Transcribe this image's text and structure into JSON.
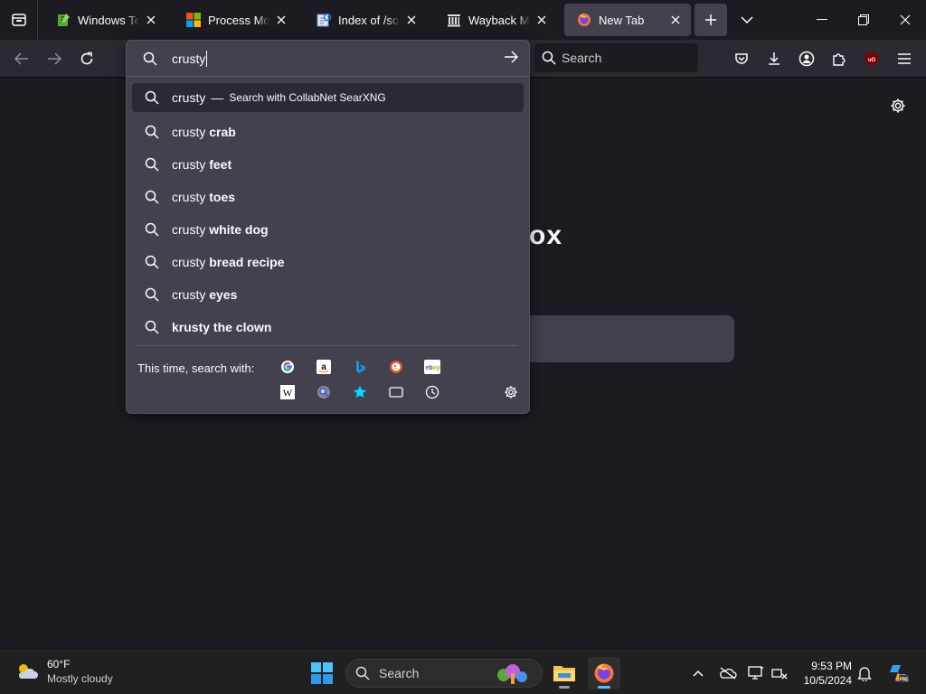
{
  "tabs": [
    {
      "title": "Windows Text Editor",
      "icon": "notepad-icon"
    },
    {
      "title": "Process Monitor",
      "icon": "windows-logo-icon"
    },
    {
      "title": "Index of /software",
      "icon": "ie-icon"
    },
    {
      "title": "Wayback Machine",
      "icon": "archive-icon"
    },
    {
      "title": "New Tab",
      "icon": "firefox-icon",
      "active": true
    }
  ],
  "navbar": {
    "search_placeholder": "Search"
  },
  "urlbar": {
    "typed_text": "crusty",
    "heuristic": {
      "prefix": "crusty",
      "separator": "—",
      "engine_text": "Search with CollabNet SearXNG"
    },
    "suggestions": [
      {
        "base": "crusty",
        "bold": "crab"
      },
      {
        "base": "crusty",
        "bold": "feet"
      },
      {
        "base": "crusty",
        "bold": "toes"
      },
      {
        "base": "crusty",
        "bold": "white dog"
      },
      {
        "base": "crusty",
        "bold": "bread recipe"
      },
      {
        "base": "crusty",
        "bold": "eyes"
      },
      {
        "base": "",
        "bold": "krusty the clown"
      }
    ],
    "oneoff_label": "This time, search with:",
    "oneoff_engines": [
      "google",
      "amazon",
      "bing",
      "duckduckgo",
      "ebay",
      "wikipedia",
      "searxng",
      "bookmarks",
      "tabs",
      "history"
    ]
  },
  "page": {
    "logo_fragment": "ox"
  },
  "taskbar": {
    "weather_temp": "60°F",
    "weather_cond": "Mostly cloudy",
    "search_placeholder": "Search",
    "time": "9:53 PM",
    "date": "10/5/2024"
  },
  "colors": {
    "accent": "#4cc2ff",
    "panel": "#42414d",
    "toolbar": "#2b2a33",
    "background": "#1c1b22"
  }
}
